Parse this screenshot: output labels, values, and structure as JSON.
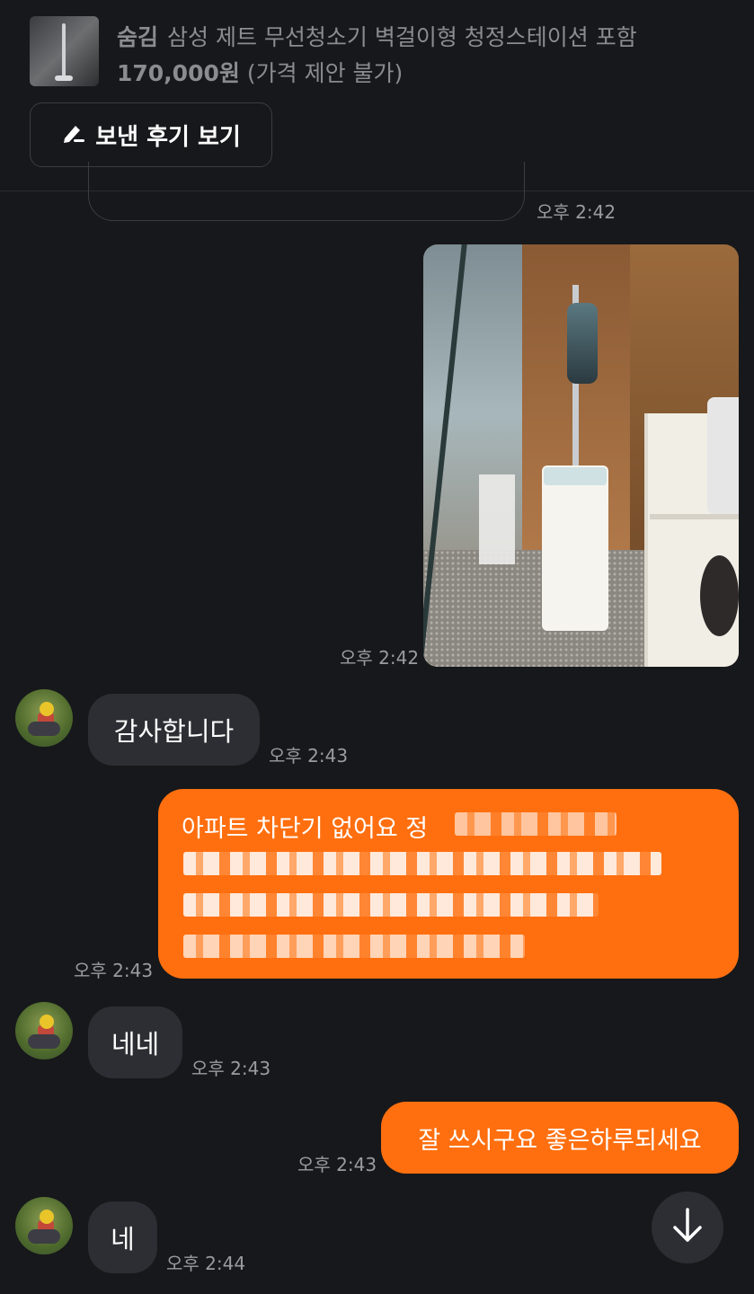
{
  "product": {
    "status": "숨김",
    "title": "삼성 제트 무선청소기 벽걸이형 청정스테이션 포함",
    "price": "170,000원",
    "price_note": "(가격 제안 불가)"
  },
  "review_button": {
    "label": "보낸 후기 보기",
    "icon": "pencil-icon"
  },
  "messages": [
    {
      "type": "partial",
      "time": "오후 2:42"
    },
    {
      "type": "image",
      "direction": "outgoing",
      "time": "오후 2:42"
    },
    {
      "type": "text",
      "direction": "incoming",
      "text": "감사합니다",
      "time": "오후 2:43"
    },
    {
      "type": "text",
      "direction": "outgoing",
      "text": "아파트 차단기 없어요 정",
      "blurred": true,
      "time": "오후 2:43"
    },
    {
      "type": "text",
      "direction": "incoming",
      "text": "네네",
      "time": "오후 2:43"
    },
    {
      "type": "text",
      "direction": "outgoing",
      "text": "잘 쓰시구요 좋은하루되세요",
      "time": "오후 2:43"
    },
    {
      "type": "text",
      "direction": "incoming",
      "text": "네",
      "time": "오후 2:44"
    }
  ],
  "scroll_button": {
    "icon": "arrow-down-icon"
  },
  "colors": {
    "background": "#17181b",
    "outgoing": "#ff6f0f",
    "incoming": "#2c2e33"
  }
}
